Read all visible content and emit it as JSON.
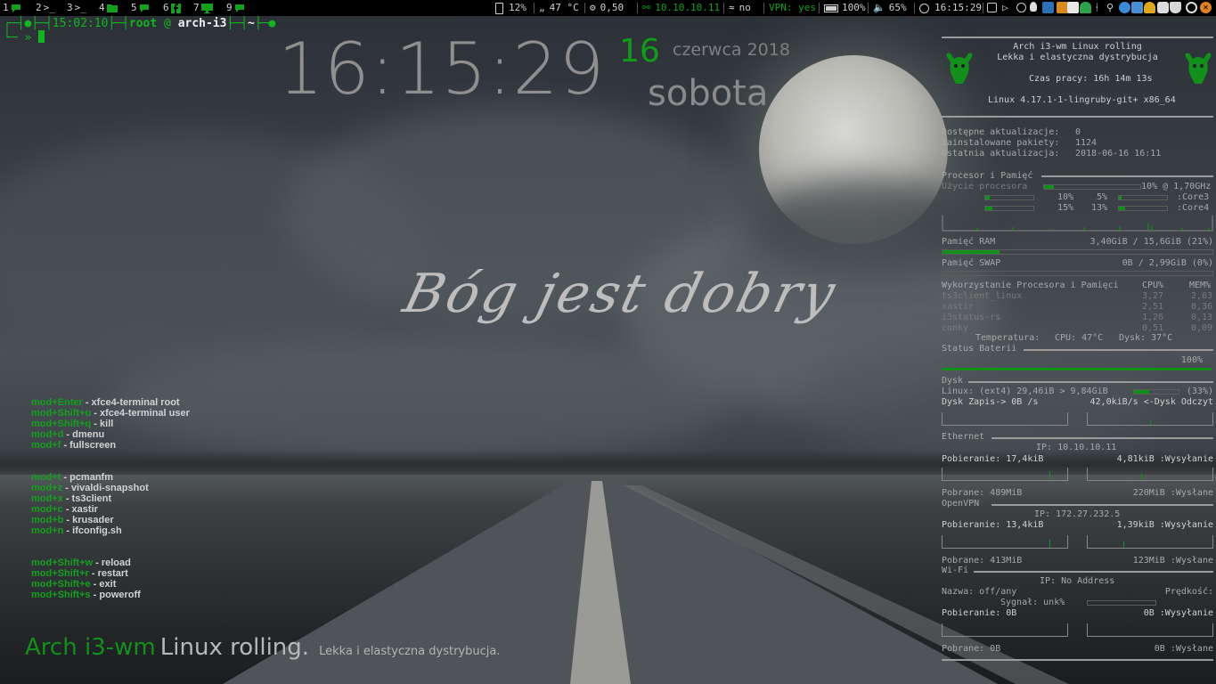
{
  "topbar": {
    "workspaces": [
      {
        "num": "1",
        "icon": "chat-icon"
      },
      {
        "num": "2",
        "icon": "terminal-icon"
      },
      {
        "num": "3",
        "icon": "terminal-icon"
      },
      {
        "num": "4",
        "icon": "folder-icon"
      },
      {
        "num": "5",
        "icon": "chat-icon"
      },
      {
        "num": "6",
        "icon": "facebook-icon"
      },
      {
        "num": "7",
        "icon": "monitor-icon"
      },
      {
        "num": "9",
        "icon": "chat-icon"
      }
    ],
    "disk": "12%",
    "temp": "47 °C",
    "load": "0,50",
    "ip": "10.10.10.11",
    "wifi": "no",
    "vpn": "VPN: yes",
    "battery": "100%",
    "volume": "65%",
    "time": "16:15:29"
  },
  "terminal": {
    "line1_time": "15:02:10",
    "user": "root",
    "at": "@",
    "host": "arch-i3",
    "path": "~",
    "prompt": "»"
  },
  "clock": {
    "time": "16:15:29",
    "day": "16",
    "month_year": "czerwca 2018",
    "weekday": "sobota"
  },
  "motto": "Bóg jest dobry",
  "keybinds": {
    "group1": [
      {
        "key": "mod+Enter",
        "desc": "xfce4-terminal root"
      },
      {
        "key": "mod+Shift+u",
        "desc": "xfce4-terminal user"
      },
      {
        "key": "mod+Shift+q",
        "desc": "kill"
      },
      {
        "key": "mod+d",
        "desc": "dmenu"
      },
      {
        "key": "mod+f",
        "desc": "fullscreen"
      }
    ],
    "group2": [
      {
        "key": "mod+t",
        "desc": "pcmanfm"
      },
      {
        "key": "mod+z",
        "desc": "vivaldi-snapshot"
      },
      {
        "key": "mod+x",
        "desc": "ts3client"
      },
      {
        "key": "mod+c",
        "desc": "xastir"
      },
      {
        "key": "mod+b",
        "desc": "krusader"
      },
      {
        "key": "mod+n",
        "desc": "ifconfig.sh"
      }
    ],
    "group3": [
      {
        "key": "mod+Shift+w",
        "desc": "reload"
      },
      {
        "key": "mod+Shift+r",
        "desc": "restart"
      },
      {
        "key": "mod+Shift+e",
        "desc": "exit"
      },
      {
        "key": "mod+Shift+s",
        "desc": "poweroff"
      }
    ]
  },
  "banner": {
    "a": "Arch i3-wm",
    "b": "Linux rolling.",
    "c": "Lekka i elastyczna dystrybucja."
  },
  "conky": {
    "title1": "Arch i3-wm Linux rolling",
    "title2": "Lekka i elastyczna dystrybucja",
    "uptime_label": "Czas pracy:",
    "uptime": "16h 14m 13s",
    "kernel": "Linux 4.17.1-1-lingruby-git+ x86_64",
    "updates_label": "Dostępne aktualizacje:",
    "updates": "0",
    "installed_label": "Zainstalowane pakiety:",
    "installed": "1124",
    "last_update_label": "Ostatnia aktualizacja:",
    "last_update": "2018-06-16 16:11",
    "cpu_header": "Procesor i Pamięć",
    "cpu_label": "Użycie procesora",
    "cpu_total": "10% @ 1,70GHz",
    "cpu_total_frac": 0.1,
    "core1": "10%",
    "core2": "5%",
    "core2_label": ":Core3",
    "core3": "15%",
    "core4": "13%",
    "core4_label": ":Core4",
    "core_fracs": [
      0.1,
      0.05,
      0.15,
      0.13
    ],
    "ram_label": "Pamięć RAM",
    "ram": "3,40GiB / 15,6GiB (21%)",
    "ram_frac": 0.21,
    "swap_label": "Pamięć SWAP",
    "swap": "0B   / 2,99GiB (0%)",
    "swap_frac": 0,
    "proc_header": "Wykorzystanie Procesora i Pamięci",
    "proc_cpu_col": "CPU%",
    "proc_mem_col": "MEM%",
    "processes": [
      {
        "name": "ts3client_linux",
        "cpu": "3,27",
        "mem": "2,03"
      },
      {
        "name": "xastir",
        "cpu": "2,51",
        "mem": "0,36"
      },
      {
        "name": "i3status-rs",
        "cpu": "1,26",
        "mem": "0,13"
      },
      {
        "name": "conky",
        "cpu": "0,51",
        "mem": "0,09"
      }
    ],
    "temp_label": "Temperatura:",
    "temp_cpu": "CPU: 47°C",
    "temp_disk": "Dysk: 37°C",
    "battery_header": "Status Baterii",
    "battery": "100%",
    "battery_frac": 1,
    "disk_header": "Dysk",
    "disk_line": "Linux: (ext4)    29,46iB > 9,84GiB",
    "disk_pct": "(33%)",
    "disk_frac": 0.33,
    "disk_write": "Dysk Zapis-> 0B  /s",
    "disk_read": "42,0kiB/s <-Dysk Odczyt",
    "eth_header": "Ethernet",
    "eth_ip": "IP: 10.10.10.11",
    "eth_down": "Pobieranie: 17,4kiB",
    "eth_up": "4,81kiB  :Wysyłanie",
    "eth_total_down": "Pobrane: 489MiB",
    "eth_total_up": "220MiB :Wysłane",
    "vpn_header": "OpenVPN",
    "vpn_ip": "IP: 172.27.232.5",
    "vpn_down": "Pobieranie: 13,4kiB",
    "vpn_up": "1,39kiB  :Wysyłanie",
    "vpn_total_down": "Pobrane: 413MiB",
    "vpn_total_up": "123MiB :Wysłane",
    "wifi_header": "Wi-Fi",
    "wifi_ip": "IP: No Address",
    "wifi_name": "Nazwa: off/any",
    "wifi_speed": "Prędkość:",
    "wifi_signal": "Sygnał: unk%",
    "wifi_down": "Pobieranie: 0B",
    "wifi_up": "0B  :Wysyłanie",
    "wifi_total_down": "Pobrane: 0B",
    "wifi_total_up": "0B  :Wysłane"
  }
}
